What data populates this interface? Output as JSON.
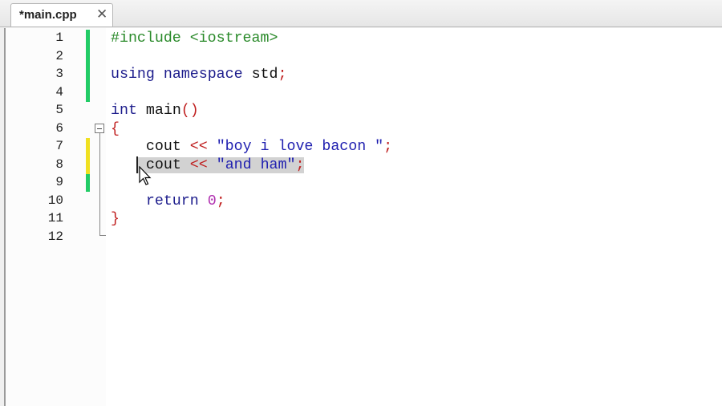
{
  "tab": {
    "label": "*main.cpp",
    "close": "✕"
  },
  "line_numbers": [
    "1",
    "2",
    "3",
    "4",
    "5",
    "6",
    "7",
    "8",
    "9",
    "10",
    "11",
    "12"
  ],
  "change_markers": {
    "saved_color": "#22cc66",
    "unsaved_color": "#f0e020"
  },
  "code": {
    "l1": {
      "a": "#include <iostream>"
    },
    "l3": {
      "a": "using",
      "b": "namespace",
      "c": "std",
      "d": ";"
    },
    "l5": {
      "a": "int",
      "b": "main",
      "c": "()"
    },
    "l6": {
      "a": "{"
    },
    "l7": {
      "a": "cout",
      "b": "<<",
      "c": "\"boy i love bacon \"",
      "d": ";"
    },
    "l8": {
      "a": "cout",
      "b": "<<",
      "c": "\"and ham\"",
      "d": ";"
    },
    "l10": {
      "a": "return",
      "b": "0",
      "c": ";"
    },
    "l11": {
      "a": "}"
    }
  }
}
